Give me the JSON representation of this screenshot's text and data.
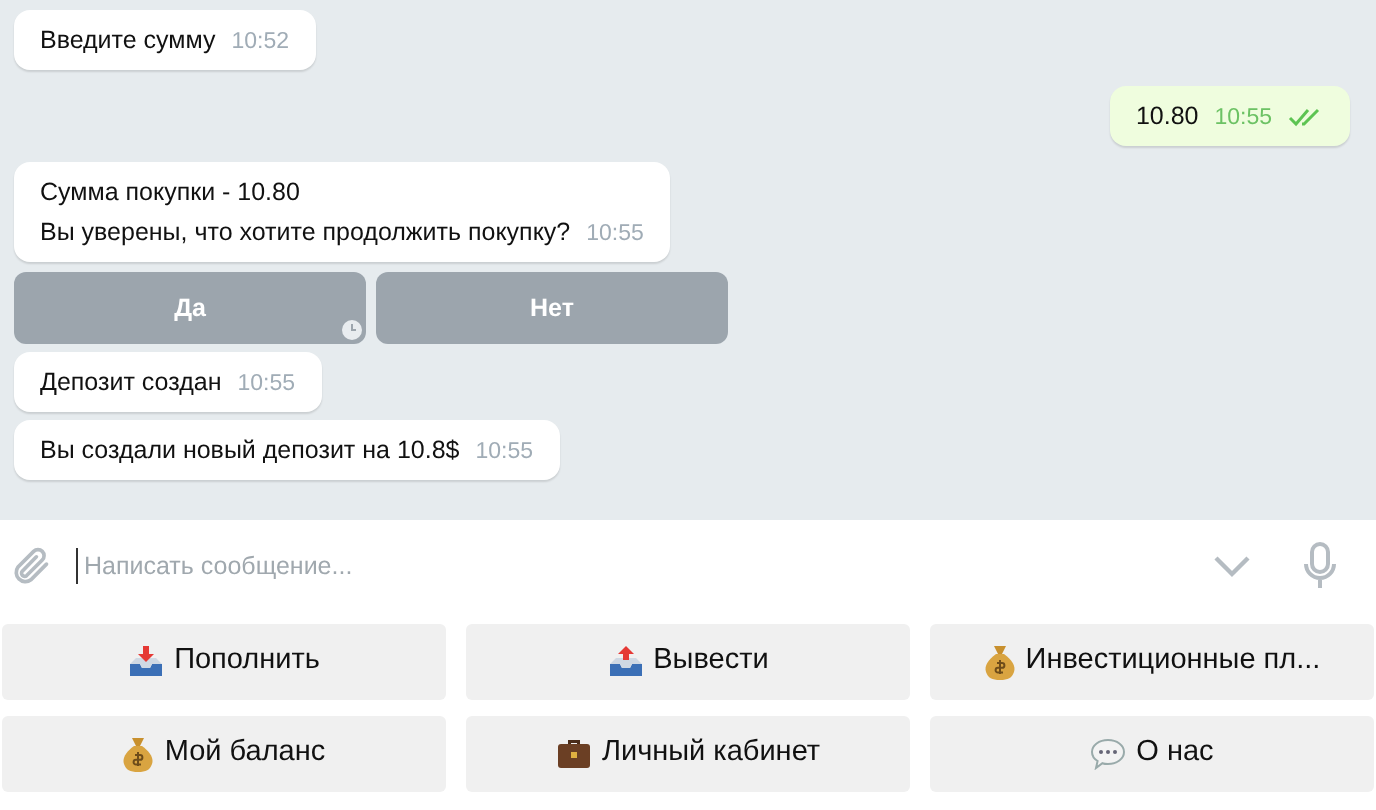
{
  "messages": [
    {
      "kind": "in",
      "lines": [
        "Введите сумму"
      ],
      "time": "10:52"
    },
    {
      "kind": "out",
      "lines": [
        "10.80"
      ],
      "time": "10:55",
      "read": true
    },
    {
      "kind": "in",
      "lines": [
        "Сумма покупки - 10.80",
        "Вы уверены, что хотите продолжить покупку?"
      ],
      "time": "10:55",
      "buttons": [
        {
          "label": "Да",
          "pending": true
        },
        {
          "label": "Нет",
          "pending": false
        }
      ]
    },
    {
      "kind": "in",
      "lines": [
        "Депозит создан"
      ],
      "time": "10:55"
    },
    {
      "kind": "in",
      "lines": [
        "Вы создали новый депозит на 10.8$"
      ],
      "time": "10:55"
    }
  ],
  "composer": {
    "placeholder": "Написать сообщение..."
  },
  "keyboard": [
    [
      {
        "kind": "inbox",
        "label": "Пополнить"
      },
      {
        "kind": "outbox",
        "label": "Вывести"
      },
      {
        "kind": "moneybag",
        "label": "Инвестиционные пл..."
      }
    ],
    [
      {
        "kind": "moneybag",
        "label": "Мой баланс"
      },
      {
        "kind": "briefcase",
        "label": "Личный кабинет"
      },
      {
        "kind": "speech",
        "label": "О нас"
      }
    ]
  ]
}
